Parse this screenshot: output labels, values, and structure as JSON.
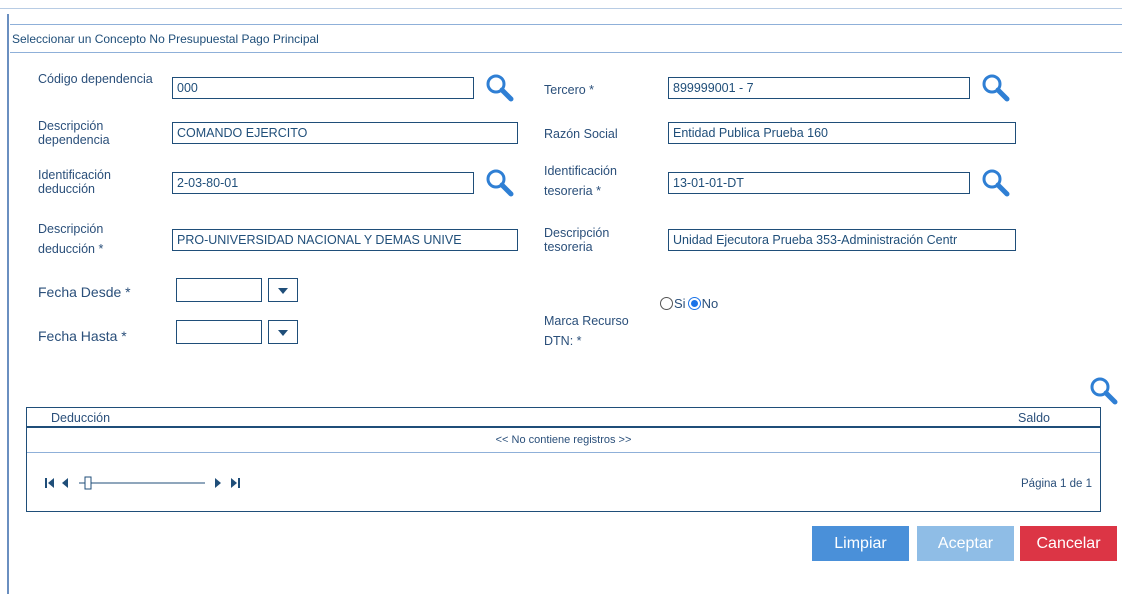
{
  "dialog": {
    "title": "Seleccionar un Concepto No Presupuestal Pago Principal"
  },
  "form": {
    "codigo_dependencia": {
      "label": "Código dependencia",
      "value": "000"
    },
    "descripcion_dependencia": {
      "label": "Descripción dependencia",
      "value": "COMANDO EJERCITO"
    },
    "identificacion_deduccion": {
      "label": "Identificación deducción",
      "value": "2-03-80-01"
    },
    "descripcion_deduccion": {
      "label": "Descripción deducción *",
      "value": "PRO-UNIVERSIDAD NACIONAL Y DEMAS UNIVE"
    },
    "fecha_desde": {
      "label": "Fecha Desde *",
      "value": ""
    },
    "fecha_hasta": {
      "label": "Fecha Hasta *",
      "value": ""
    },
    "tercero": {
      "label": "Tercero *",
      "value": "899999001 - 7"
    },
    "razon_social": {
      "label": "Razón Social",
      "value": "Entidad Publica Prueba 160"
    },
    "identificacion_tesoreria": {
      "label": "Identificación tesoreria *",
      "value": "13-01-01-DT"
    },
    "descripcion_tesoreria": {
      "label": "Descripción tesoreria",
      "value": "Unidad Ejecutora Prueba 353-Administración Centr"
    },
    "marca_recurso": {
      "label": "Marca Recurso DTN: *",
      "option_si": "Si",
      "option_no": "No",
      "selected": "No"
    }
  },
  "grid": {
    "columns": [
      "Deducción",
      "Saldo"
    ],
    "empty_message": "<< No contiene registros >>",
    "page_text": "Página 1 de 1"
  },
  "buttons": {
    "limpiar": "Limpiar",
    "aceptar": "Aceptar",
    "cancelar": "Cancelar"
  },
  "colors": {
    "accent": "#4a90d9",
    "accent_disabled": "#8fbde6",
    "danger": "#dc3545",
    "border": "#1f4e79"
  },
  "icons": {
    "search": "magnifier-icon",
    "dropdown": "chevron-down-icon"
  }
}
